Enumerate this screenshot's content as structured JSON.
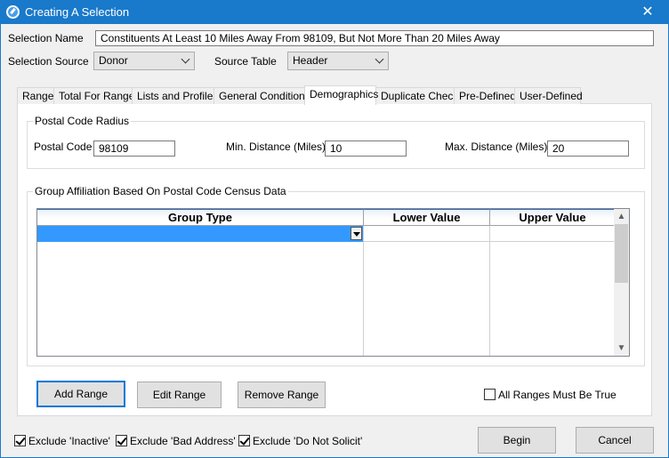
{
  "window": {
    "title": "Creating A Selection",
    "close_label": "✕"
  },
  "header": {
    "selection_name_label": "Selection Name",
    "selection_name_value": "Constituents At Least 10 Miles Away From 98109, But Not More Than 20 Miles Away",
    "selection_source_label": "Selection Source",
    "selection_source_value": "Donor",
    "source_table_label": "Source Table",
    "source_table_value": "Header"
  },
  "tabs": [
    {
      "label": "Range"
    },
    {
      "label": "Total For Range"
    },
    {
      "label": "Lists and Profiles"
    },
    {
      "label": "General Conditions"
    },
    {
      "label": "Demographics"
    },
    {
      "label": "Duplicate Check"
    },
    {
      "label": "Pre-Defined"
    },
    {
      "label": "User-Defined"
    }
  ],
  "postal": {
    "group_title": "Postal Code Radius",
    "postal_code_label": "Postal Code",
    "postal_code_value": "98109",
    "min_label": "Min. Distance (Miles)",
    "min_value": "10",
    "max_label": "Max. Distance (Miles)",
    "max_value": "20"
  },
  "affiliation": {
    "group_title": "Group Affiliation Based On Postal Code Census Data",
    "columns": [
      "Group Type",
      "Lower Value",
      "Upper Value"
    ]
  },
  "actions": {
    "add_range": "Add Range",
    "edit_range": "Edit Range",
    "remove_range": "Remove Range",
    "all_ranges_label": "All Ranges Must Be True"
  },
  "footer": {
    "exclude_inactive": "Exclude 'Inactive'",
    "exclude_bad_address": "Exclude 'Bad Address'",
    "exclude_do_not_solicit": "Exclude 'Do Not Solicit'",
    "begin": "Begin",
    "cancel": "Cancel"
  }
}
